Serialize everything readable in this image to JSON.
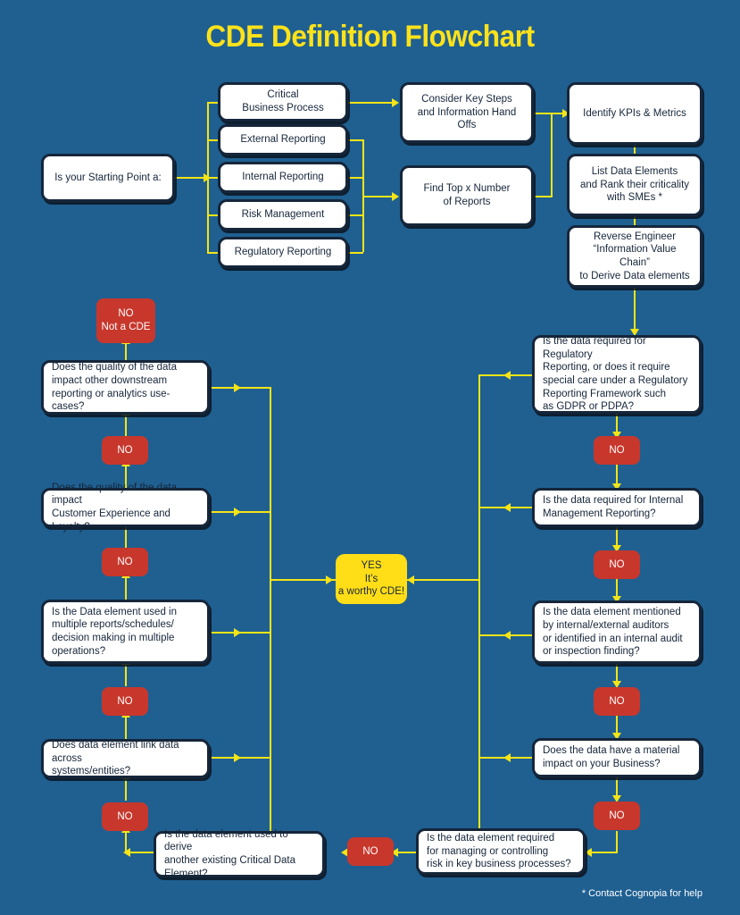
{
  "page": {
    "title": "CDE Definition Flowchart",
    "footnote": "* Contact Cognopia for help",
    "colors": {
      "background": "#1F6091",
      "connector": "#F5E416",
      "title": "#FFE21A",
      "box_fill": "#FFFFFF",
      "box_border": "#16263A",
      "no_fill": "#C8372C",
      "yes_fill": "#FFDD17"
    }
  },
  "nodes": {
    "start": {
      "label": "Is your Starting Point a:"
    },
    "start_options": [
      {
        "label": "Critical\nBusiness Process"
      },
      {
        "label": "External Reporting"
      },
      {
        "label": "Internal Reporting"
      },
      {
        "label": "Risk Management"
      },
      {
        "label": "Regulatory Reporting"
      }
    ],
    "process_mid": [
      {
        "label": "Consider Key Steps\nand Information Hand Offs"
      },
      {
        "label": "Find Top x Number\nof Reports"
      }
    ],
    "process_right": [
      {
        "label": "Identify KPIs & Metrics"
      },
      {
        "label": "List Data Elements\nand Rank their criticality\nwith SMEs *"
      },
      {
        "label": "Reverse Engineer\n“Information Value Chain”\nto Derive Data elements"
      }
    ],
    "right_questions": [
      {
        "label": "Is the data required for Regulatory\nReporting, or does it require\nspecial care under a Regulatory\nReporting Framework such\nas GDPR or PDPA?"
      },
      {
        "label": "Is the data required for Internal\nManagement Reporting?"
      },
      {
        "label": "Is the data element mentioned\nby internal/external auditors\nor identified in an internal audit\nor inspection finding?"
      },
      {
        "label": "Does the data have a material\nimpact on your Business?"
      }
    ],
    "bottom_questions": [
      {
        "label": "Is the data element required\nfor managing or controlling\nrisk in key business processes?"
      },
      {
        "label": "Is the data element used to derive\nanother existing Critical Data\nElement?"
      }
    ],
    "left_questions": [
      {
        "label": "Does data element link data across\nsystems/entities?"
      },
      {
        "label": "Is the Data element used in\nmultiple reports/schedules/\ndecision making in multiple\noperations?"
      },
      {
        "label": "Does the quality of the data impact\nCustomer Experience and Loyalty?"
      },
      {
        "label": "Does the quality of the data\nimpact other downstream\nreporting or analytics use-cases?"
      }
    ],
    "no_labels": {
      "plain": "NO",
      "terminal": "NO\nNot a CDE"
    },
    "yes_box": {
      "label": "YES\nIt’s\na worthy CDE!"
    }
  }
}
